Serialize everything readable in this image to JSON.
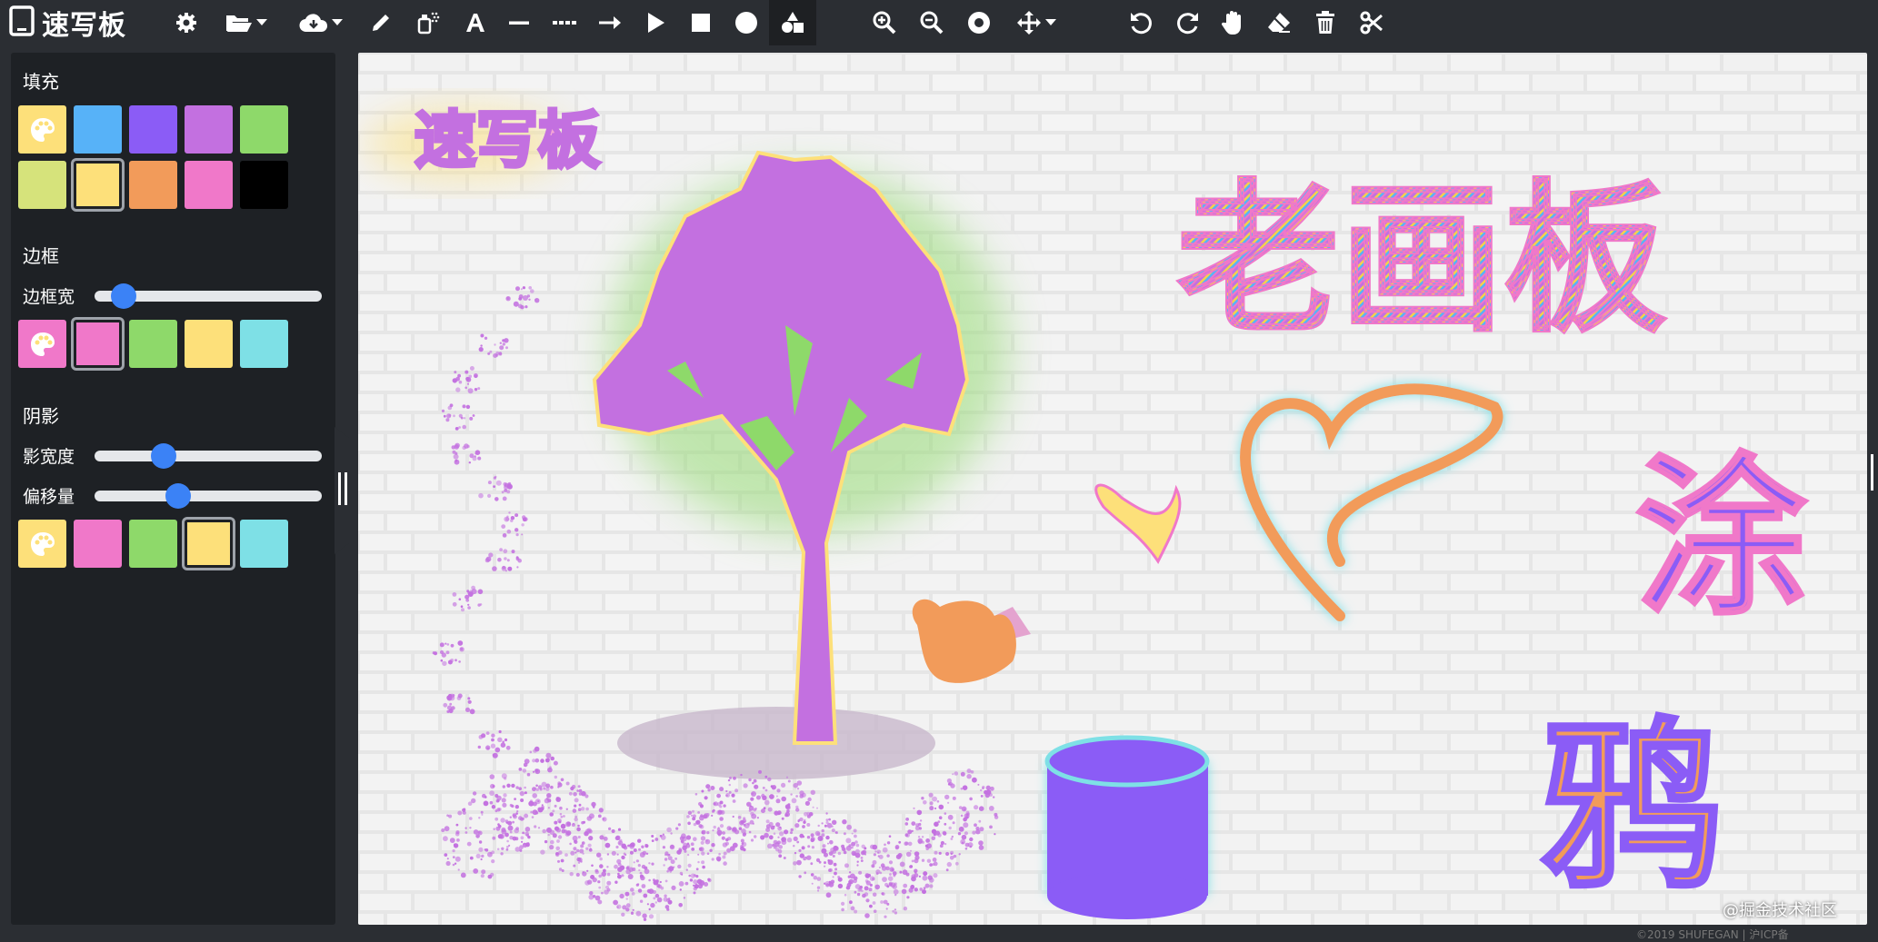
{
  "app": {
    "title": "速写板"
  },
  "toolbar": {
    "tools": [
      {
        "id": "settings",
        "icon": "gear-icon"
      },
      {
        "id": "open",
        "icon": "folder-open-icon",
        "dropdown": true
      },
      {
        "id": "download",
        "icon": "cloud-download-icon",
        "dropdown": true
      },
      {
        "id": "pencil",
        "icon": "pencil-icon"
      },
      {
        "id": "spray",
        "icon": "spray-icon"
      },
      {
        "id": "text",
        "icon": "text-icon"
      },
      {
        "id": "line",
        "icon": "line-icon"
      },
      {
        "id": "dotted-line",
        "icon": "dotted-line-icon"
      },
      {
        "id": "arrow",
        "icon": "arrow-icon"
      },
      {
        "id": "triangle",
        "icon": "triangle-icon"
      },
      {
        "id": "rectangle",
        "icon": "square-icon"
      },
      {
        "id": "circle",
        "icon": "circle-icon"
      },
      {
        "id": "shapes",
        "icon": "shapes-icon",
        "active": true
      },
      {
        "id": "zoom-in",
        "icon": "zoom-in-icon"
      },
      {
        "id": "zoom-out",
        "icon": "zoom-out-icon"
      },
      {
        "id": "zoom-reset",
        "icon": "target-icon"
      },
      {
        "id": "move",
        "icon": "move-icon",
        "dropdown": true
      },
      {
        "id": "undo",
        "icon": "undo-icon"
      },
      {
        "id": "redo",
        "icon": "redo-icon"
      },
      {
        "id": "pan",
        "icon": "hand-icon"
      },
      {
        "id": "eraser",
        "icon": "eraser-icon"
      },
      {
        "id": "delete",
        "icon": "trash-icon"
      },
      {
        "id": "cut",
        "icon": "scissors-icon"
      }
    ]
  },
  "sidebar": {
    "fill": {
      "title": "填充",
      "swatches": [
        "#fde07a",
        "#57b2f8",
        "#8b5cf6",
        "#c370e0",
        "#8ed96a",
        "#d6e37b",
        "#fde07a",
        "#f29b5a",
        "#f078c9",
        "#000000"
      ],
      "selected_index": 6
    },
    "border": {
      "title": "边框",
      "width_label": "边框宽",
      "width_value": 0.08,
      "swatches": [
        "#f078c9",
        "#f078c9",
        "#8ed96a",
        "#fde07a",
        "#7ee0e6"
      ],
      "selected_index": 1
    },
    "shadow": {
      "title": "阴影",
      "width_label": "影宽度",
      "width_value": 0.28,
      "offset_label": "偏移量",
      "offset_value": 0.35,
      "swatches": [
        "#fde07a",
        "#f078c9",
        "#8ed96a",
        "#fde07a",
        "#7ee0e6"
      ],
      "selected_index": 3
    }
  },
  "canvas": {
    "logo_text": "速写板",
    "title_text": "老画板",
    "text_paint": "涂",
    "text_crow": "鸦"
  },
  "footer": {
    "watermark": "@掘金技术社区",
    "copyright": "©2019 SHUFEGAN | 沪ICP备"
  }
}
